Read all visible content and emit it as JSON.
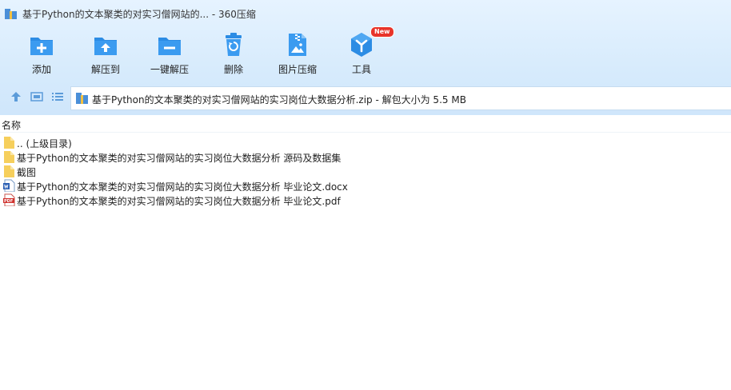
{
  "window": {
    "title": "基于Python的文本聚类的对实习僧网站的... - 360压缩"
  },
  "toolbar": {
    "items": [
      {
        "label": "添加",
        "icon": "add-icon"
      },
      {
        "label": "解压到",
        "icon": "extract-to-icon"
      },
      {
        "label": "一键解压",
        "icon": "one-click-extract-icon"
      },
      {
        "label": "删除",
        "icon": "delete-icon"
      },
      {
        "label": "图片压缩",
        "icon": "image-compress-icon"
      },
      {
        "label": "工具",
        "icon": "tools-icon",
        "badge": "New"
      }
    ]
  },
  "address": {
    "path": "基于Python的文本聚类的对实习僧网站的实习岗位大数据分析.zip - 解包大小为 5.5 MB"
  },
  "list": {
    "header_name": "名称",
    "rows": [
      {
        "name": ".. (上级目录)",
        "icon": "folder-icon"
      },
      {
        "name": "基于Python的文本聚类的对实习僧网站的实习岗位大数据分析 源码及数据集",
        "icon": "folder-icon"
      },
      {
        "name": "截图",
        "icon": "folder-icon"
      },
      {
        "name": "基于Python的文本聚类的对实习僧网站的实习岗位大数据分析 毕业论文.docx",
        "icon": "word-doc-icon"
      },
      {
        "name": "基于Python的文本聚类的对实习僧网站的实习岗位大数据分析 毕业论文.pdf",
        "icon": "pdf-icon"
      }
    ]
  },
  "colors": {
    "accent_blue": "#2c8ce4",
    "badge_red": "#e8342a",
    "folder_yellow": "#f6cf5c"
  }
}
